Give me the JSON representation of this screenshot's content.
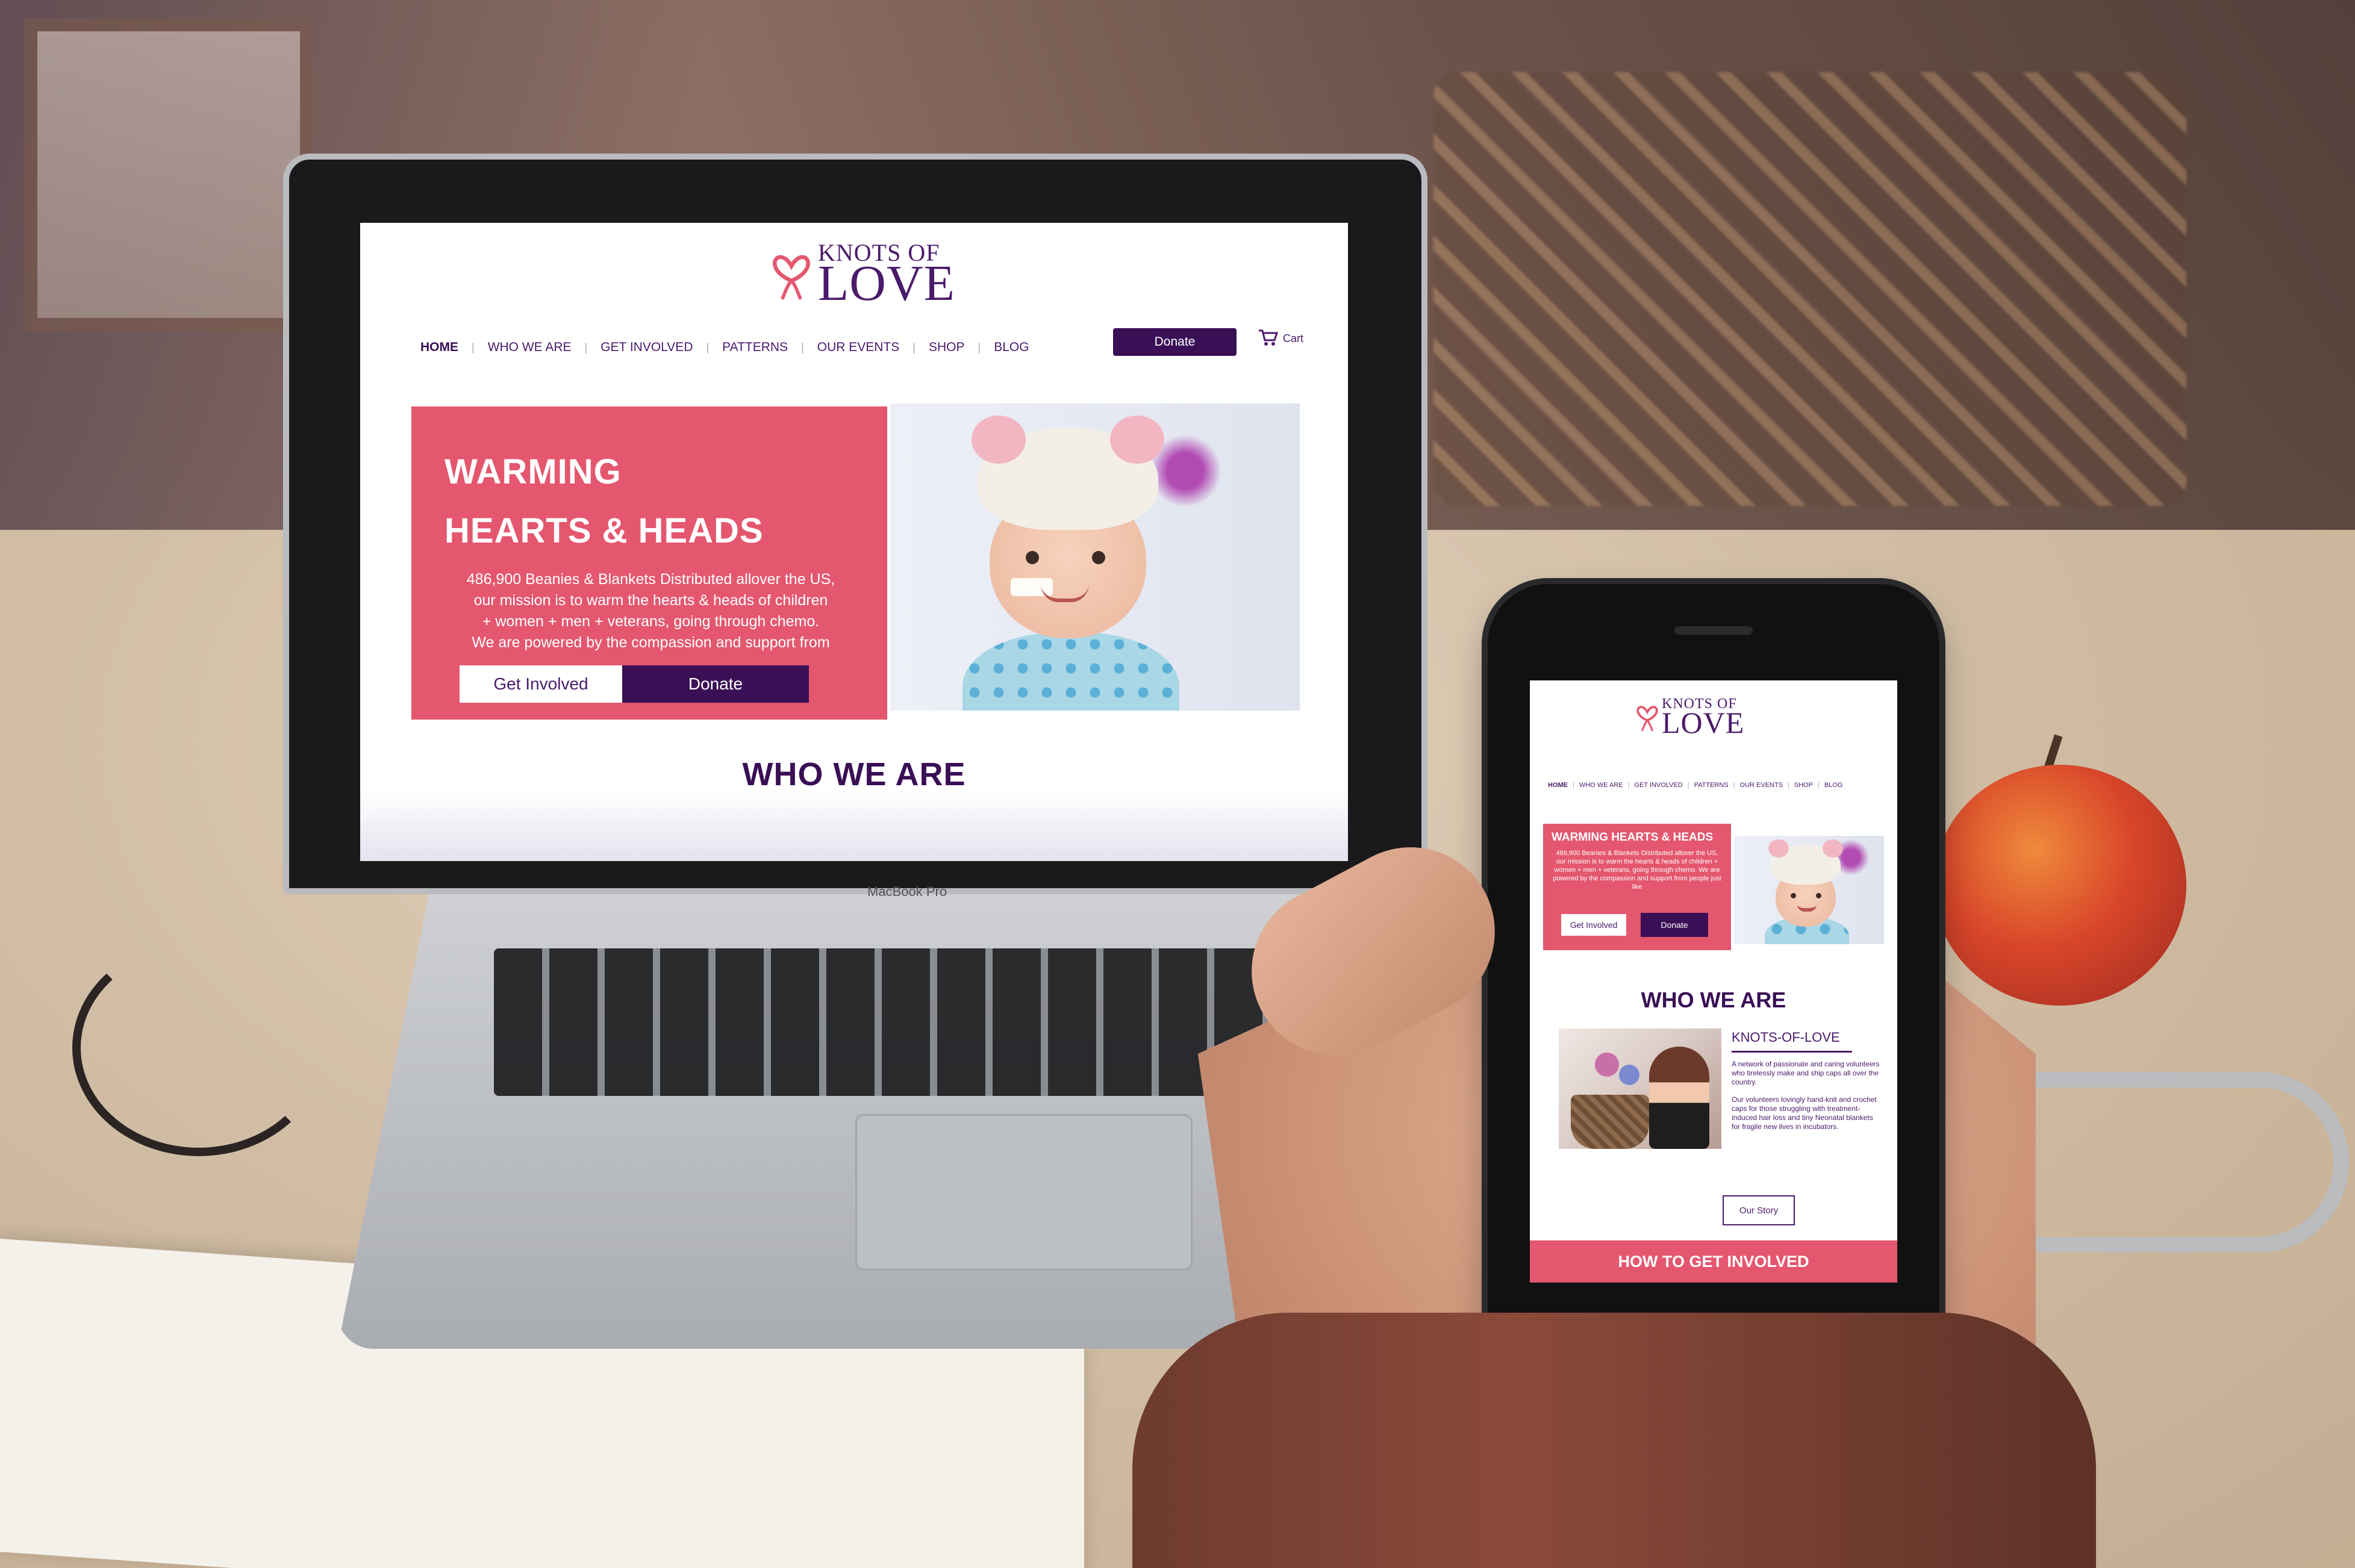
{
  "brand": {
    "line1": "KNOTS OF",
    "line2": "LOVE"
  },
  "colors": {
    "pink": "#e4576f",
    "purple": "#3a0f56",
    "text_purple": "#4a1a6b",
    "white": "#ffffff"
  },
  "laptop": {
    "brand_label": "MacBook Pro",
    "nav": {
      "items": [
        "HOME",
        "WHO WE ARE",
        "GET INVOLVED",
        "PATTERNS",
        "OUR EVENTS",
        "SHOP",
        "BLOG"
      ],
      "separator": "|"
    },
    "donate_label": "Donate",
    "cart_label": "Cart",
    "cart_icon": "cart-icon",
    "hero": {
      "title_line1": "WARMING",
      "title_line2": "HEARTS & HEADS",
      "text_line1": "486,900 Beanies & Blankets Distributed allover the US,",
      "text_line2": "our mission is to warm the hearts & heads of children",
      "text_line3": "+ women + men + veterans, going through chemo.",
      "text_line4": "We are powered by the compassion and support from",
      "get_involved_label": "Get Involved",
      "donate_label": "Donate"
    },
    "section_title": "WHO WE ARE"
  },
  "phone": {
    "nav": {
      "items": [
        "HOME",
        "WHO WE ARE",
        "GET INVOLVED",
        "PATTERNS",
        "OUR EVENTS",
        "SHOP",
        "BLOG"
      ]
    },
    "hero": {
      "title": "WARMING HEARTS & HEADS",
      "text": "486,900 Beanies & Blankets Distributed allover the US, our mission is to warm the hearts & heads of children + women + men + veterans, going through chemo. We are powered by the compassion and support from people just like",
      "get_involved_label": "Get Involved",
      "donate_label": "Donate"
    },
    "who_title": "WHO WE ARE",
    "kol_title": "KNOTS-OF-LOVE",
    "kol_p1": "A network of passionate and caring volunteers who tirelessly make and ship caps all over the country.",
    "kol_p2": "Our volunteers lovingly hand-knit and crochet caps for those struggling with treatment-induced hair loss and tiny Neonatal blankets for fragile new lives in incubators.",
    "our_story_label": "Our Story",
    "how_title": "HOW TO GET INVOLVED"
  }
}
